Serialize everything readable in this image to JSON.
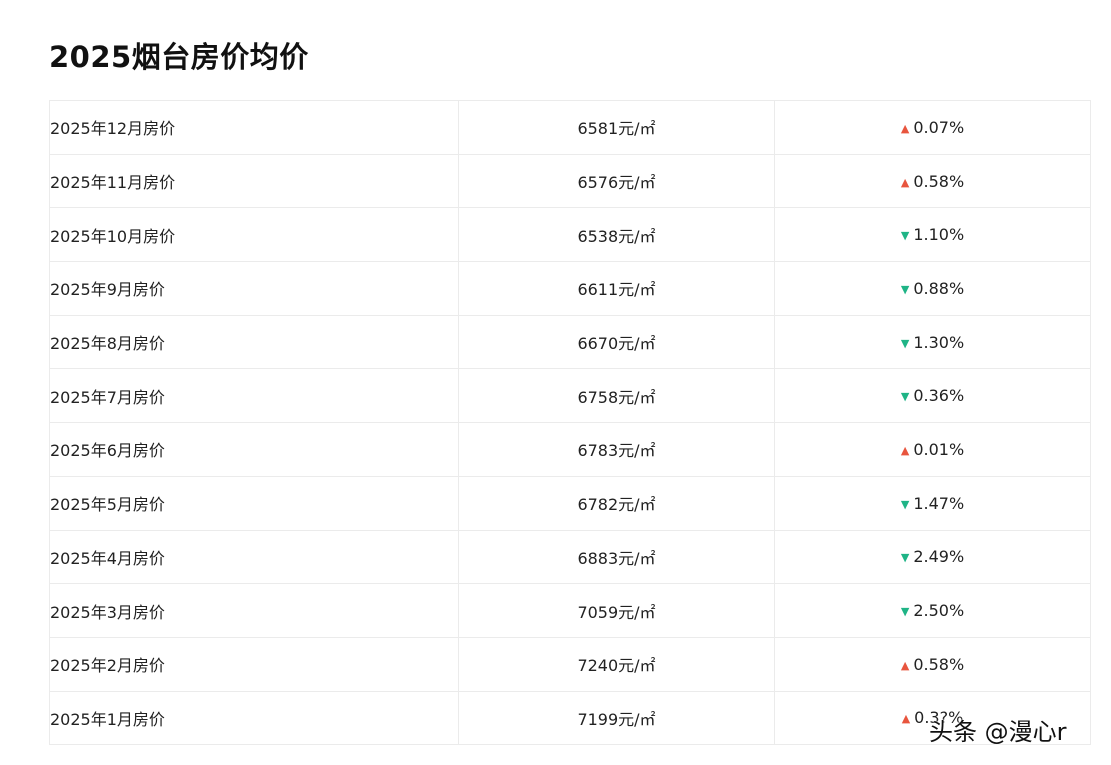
{
  "title": "2025烟台房价均价",
  "rows": [
    {
      "label": "2025年12月房价",
      "price": "6581元/㎡",
      "direction": "up",
      "change": "0.07%"
    },
    {
      "label": "2025年11月房价",
      "price": "6576元/㎡",
      "direction": "up",
      "change": "0.58%"
    },
    {
      "label": "2025年10月房价",
      "price": "6538元/㎡",
      "direction": "down",
      "change": "1.10%"
    },
    {
      "label": "2025年9月房价",
      "price": "6611元/㎡",
      "direction": "down",
      "change": "0.88%"
    },
    {
      "label": "2025年8月房价",
      "price": "6670元/㎡",
      "direction": "down",
      "change": "1.30%"
    },
    {
      "label": "2025年7月房价",
      "price": "6758元/㎡",
      "direction": "down",
      "change": "0.36%"
    },
    {
      "label": "2025年6月房价",
      "price": "6783元/㎡",
      "direction": "up",
      "change": "0.01%"
    },
    {
      "label": "2025年5月房价",
      "price": "6782元/㎡",
      "direction": "down",
      "change": "1.47%"
    },
    {
      "label": "2025年4月房价",
      "price": "6883元/㎡",
      "direction": "down",
      "change": "2.49%"
    },
    {
      "label": "2025年3月房价",
      "price": "7059元/㎡",
      "direction": "down",
      "change": "2.50%"
    },
    {
      "label": "2025年2月房价",
      "price": "7240元/㎡",
      "direction": "up",
      "change": "0.58%"
    },
    {
      "label": "2025年1月房价",
      "price": "7199元/㎡",
      "direction": "up",
      "change": "0.3?%"
    }
  ],
  "colors": {
    "up": "#e8553e",
    "down": "#1fb486"
  },
  "watermark": "头条 @漫心r"
}
